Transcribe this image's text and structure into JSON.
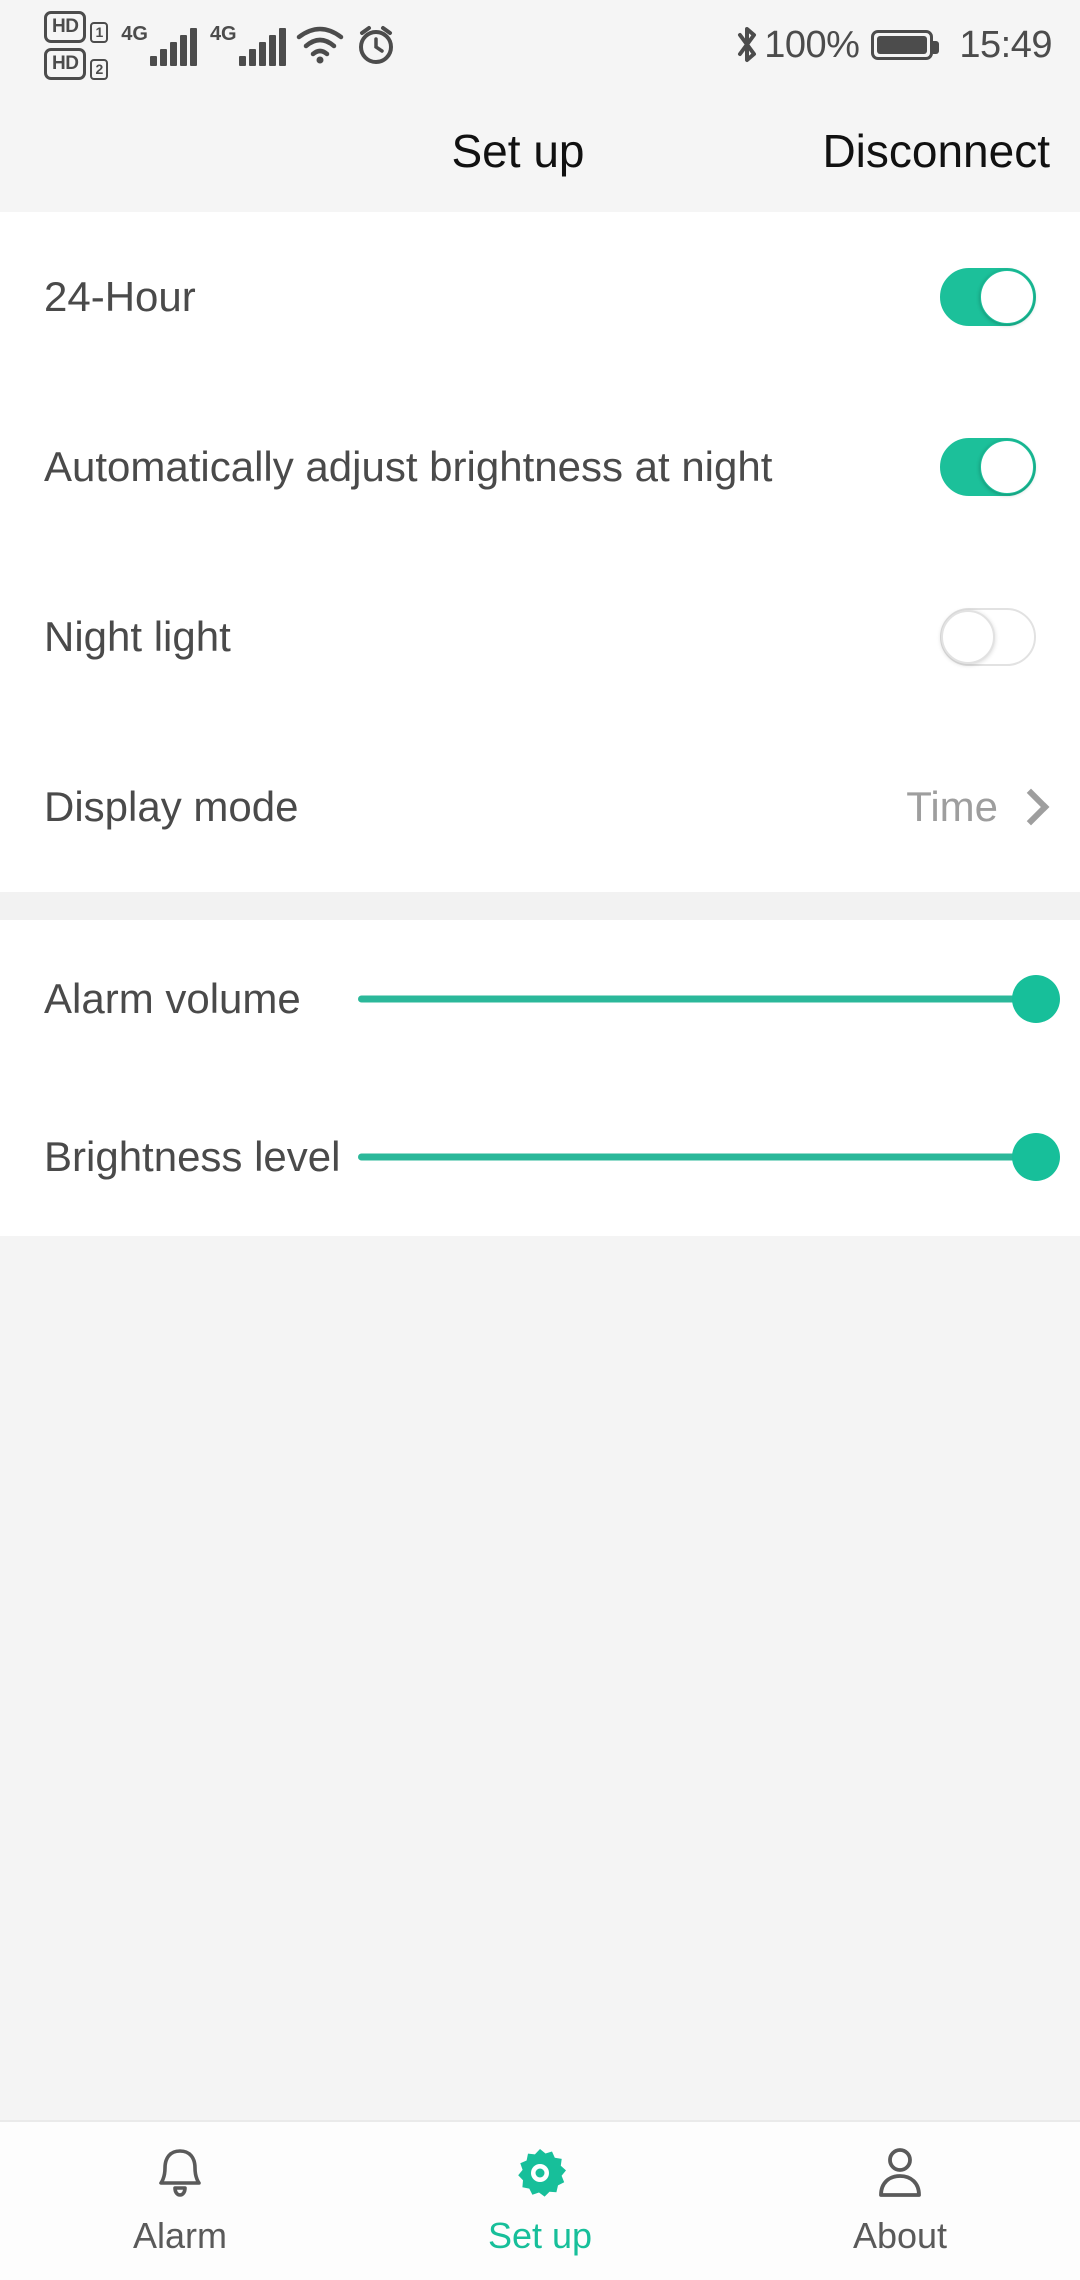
{
  "status_bar": {
    "sim1_badge": "HD",
    "sim1_num": "1",
    "sim2_badge": "HD",
    "sim2_num": "2",
    "network1": "4G",
    "network2": "4G",
    "wifi_icon": "wifi-icon",
    "alarm_icon": "alarm-clock-icon",
    "bluetooth_icon": "bluetooth-icon",
    "battery_percent": "100%",
    "battery_icon": "battery-full-icon",
    "time": "15:49"
  },
  "header": {
    "title": "Set up",
    "action_label": "Disconnect"
  },
  "settings": {
    "rows": [
      {
        "label": "24-Hour",
        "type": "toggle",
        "state": "on"
      },
      {
        "label": "Automatically adjust brightness at night",
        "type": "toggle",
        "state": "on"
      },
      {
        "label": "Night light",
        "type": "toggle",
        "state": "off"
      },
      {
        "label": "Display mode",
        "type": "nav",
        "value": "Time",
        "chevron": "chevron-right-icon"
      }
    ]
  },
  "sliders": {
    "rows": [
      {
        "label": "Alarm volume",
        "value": 100,
        "min": 0,
        "max": 100
      },
      {
        "label": "Brightness level",
        "value": 100,
        "min": 0,
        "max": 100
      }
    ]
  },
  "bottom_nav": {
    "items": [
      {
        "label": "Alarm",
        "icon": "bell-icon",
        "active": false
      },
      {
        "label": "Set up",
        "icon": "gear-icon",
        "active": true
      },
      {
        "label": "About",
        "icon": "person-icon",
        "active": false
      }
    ]
  },
  "colors": {
    "accent": "#17bf9a",
    "toggle_on": "#1cc09a",
    "text_primary": "#4a4a4a",
    "text_muted": "#9e9e9e",
    "page_bg": "#f4f4f4"
  }
}
